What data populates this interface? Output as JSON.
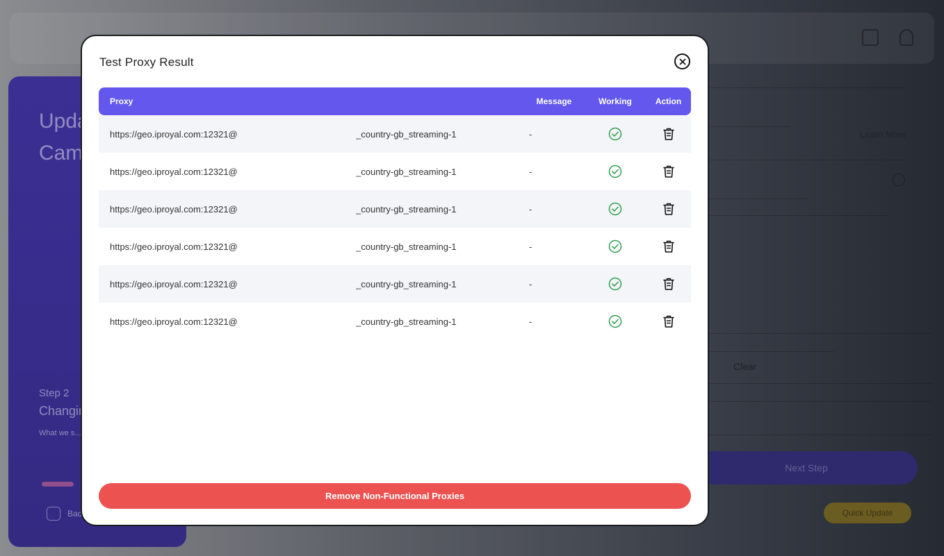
{
  "background": {
    "sidebar": {
      "title": "Update Campaign",
      "step_label": "Step 2",
      "step_title": "Changing",
      "step_desc": "What we s... campaign ...",
      "back_label": "Back"
    },
    "main": {
      "clear_label": "Clear",
      "learn_label": "Learn More",
      "next_label": "Next Step",
      "quick_label": "Quick Update"
    }
  },
  "modal": {
    "title": "Test Proxy Result",
    "columns": {
      "proxy": "Proxy",
      "message": "Message",
      "working": "Working",
      "action": "Action"
    },
    "rows": [
      {
        "proxy": "https://geo.iproyal.com:12321@",
        "user": "_country-gb_streaming-1",
        "message": "-",
        "working": true
      },
      {
        "proxy": "https://geo.iproyal.com:12321@",
        "user": "_country-gb_streaming-1",
        "message": "-",
        "working": true
      },
      {
        "proxy": "https://geo.iproyal.com:12321@",
        "user": "_country-gb_streaming-1",
        "message": "-",
        "working": true
      },
      {
        "proxy": "https://geo.iproyal.com:12321@",
        "user": "_country-gb_streaming-1",
        "message": "-",
        "working": true
      },
      {
        "proxy": "https://geo.iproyal.com:12321@",
        "user": "_country-gb_streaming-1",
        "message": "-",
        "working": true
      },
      {
        "proxy": "https://geo.iproyal.com:12321@",
        "user": "_country-gb_streaming-1",
        "message": "-",
        "working": true
      }
    ],
    "remove_button": "Remove Non-Functional Proxies",
    "colors": {
      "header": "#6457ee",
      "success": "#2e9e4f",
      "danger": "#ec5250"
    },
    "icons": {
      "close": "close-circle-icon",
      "working": "check-circle-icon",
      "action": "trash-icon"
    }
  }
}
